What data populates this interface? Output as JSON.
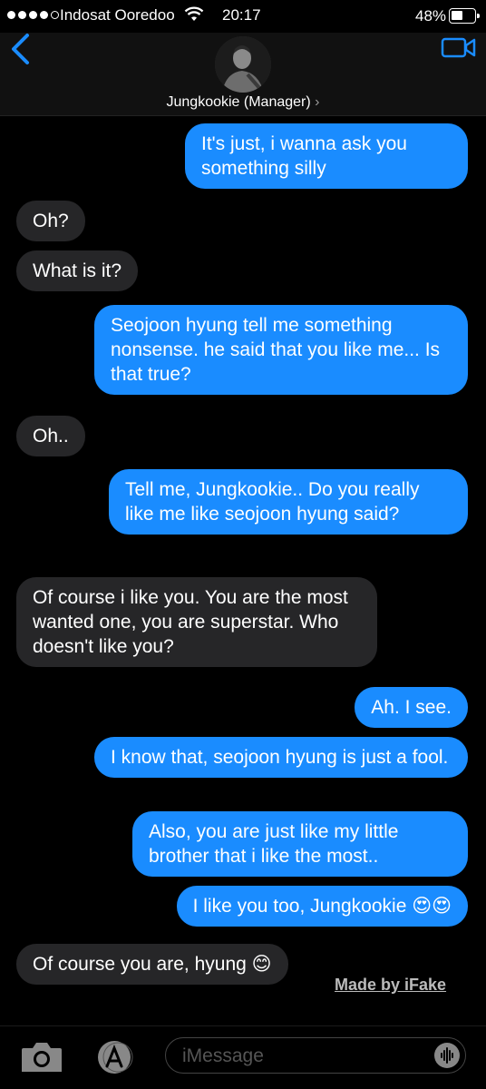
{
  "status_bar": {
    "carrier": "Indosat Ooredoo",
    "time": "20:17",
    "battery": "48%"
  },
  "header": {
    "contact_name": "Jungkookie (Manager)",
    "chevron": "›"
  },
  "messages": [
    {
      "side": "sent",
      "text": "It's just, i wanna ask you something silly"
    },
    {
      "side": "recv",
      "text": "Oh?"
    },
    {
      "side": "recv",
      "text": "What is it?"
    },
    {
      "side": "sent",
      "text": "Seojoon hyung tell me something nonsense. he said that you like me... Is that true?"
    },
    {
      "side": "recv",
      "text": "Oh.."
    },
    {
      "side": "sent",
      "text": "Tell me, Jungkookie.. Do you really like me like seojoon hyung said?"
    },
    {
      "side": "recv",
      "text": "Of course i like you. You are the most wanted one, you are superstar. Who doesn't like you?"
    },
    {
      "side": "sent",
      "text": "Ah. I see."
    },
    {
      "side": "sent",
      "text": "I know that, seojoon hyung is just a fool."
    },
    {
      "side": "sent",
      "text": "Also, you are just like my little brother that i like the most.."
    },
    {
      "side": "sent",
      "text": "I like you too, Jungkookie 😍😍"
    },
    {
      "side": "recv",
      "text": "Of course you are, hyung 😊"
    }
  ],
  "watermark": "Made by iFake",
  "input": {
    "placeholder": "iMessage"
  },
  "colors": {
    "sent_bubble": "#1a8cff",
    "received_bubble": "#262628",
    "accent": "#1a8cff"
  },
  "icons": [
    "back-chevron-icon",
    "video-camera-icon",
    "camera-icon",
    "app-store-icon",
    "audio-wave-icon",
    "wifi-icon",
    "battery-icon"
  ]
}
